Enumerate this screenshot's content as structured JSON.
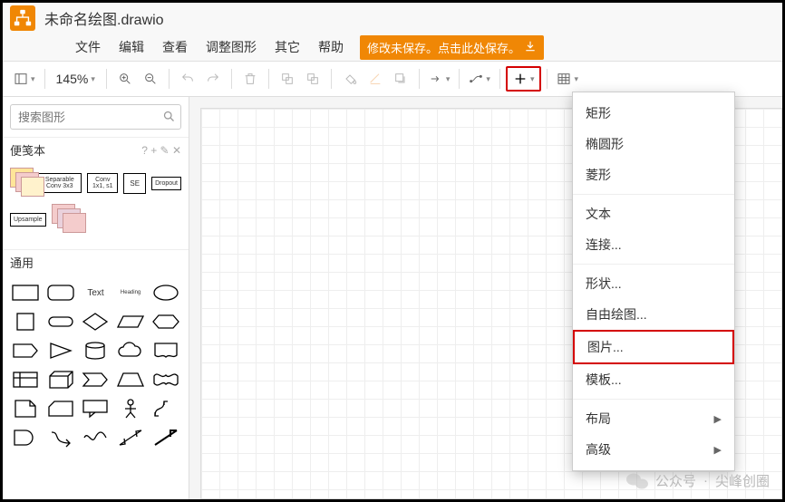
{
  "title": "未命名绘图.drawio",
  "menubar": [
    "文件",
    "编辑",
    "查看",
    "调整图形",
    "其它",
    "帮助"
  ],
  "save_notice": {
    "text": "修改未保存。点击此处保存。",
    "icon": "download-icon"
  },
  "toolbar": {
    "zoom_value": "145%",
    "buttons": [
      "view-mode",
      "zoom",
      "zoom-in",
      "zoom-out",
      "undo",
      "redo",
      "delete",
      "to-front",
      "to-back",
      "fill",
      "stroke",
      "shadow",
      "line-start",
      "line-style",
      "waypoint",
      "add",
      "table"
    ]
  },
  "sidebar": {
    "search_placeholder": "搜索图形",
    "scratchpad_label": "便笺本",
    "scratchpad_items": [
      "Separable Conv 3x3",
      "Conv 1x1, s1",
      "SE",
      "Dropout",
      "Upsample"
    ],
    "general_label": "通用",
    "text_label": "Text",
    "heading_label": "Heading"
  },
  "dropdown": {
    "items": [
      {
        "label": "矩形",
        "kind": "item"
      },
      {
        "label": "椭圆形",
        "kind": "item"
      },
      {
        "label": "菱形",
        "kind": "item"
      },
      {
        "kind": "sep"
      },
      {
        "label": "文本",
        "kind": "item"
      },
      {
        "label": "连接...",
        "kind": "item"
      },
      {
        "kind": "sep"
      },
      {
        "label": "形状...",
        "kind": "item"
      },
      {
        "label": "自由绘图...",
        "kind": "item"
      },
      {
        "label": "图片...",
        "kind": "item",
        "highlight": true
      },
      {
        "label": "模板...",
        "kind": "item"
      },
      {
        "kind": "sep"
      },
      {
        "label": "布局",
        "kind": "submenu"
      },
      {
        "label": "高级",
        "kind": "submenu"
      }
    ]
  },
  "watermark": {
    "prefix": "公众号",
    "dot": "·",
    "name": "尖峰创圈"
  }
}
